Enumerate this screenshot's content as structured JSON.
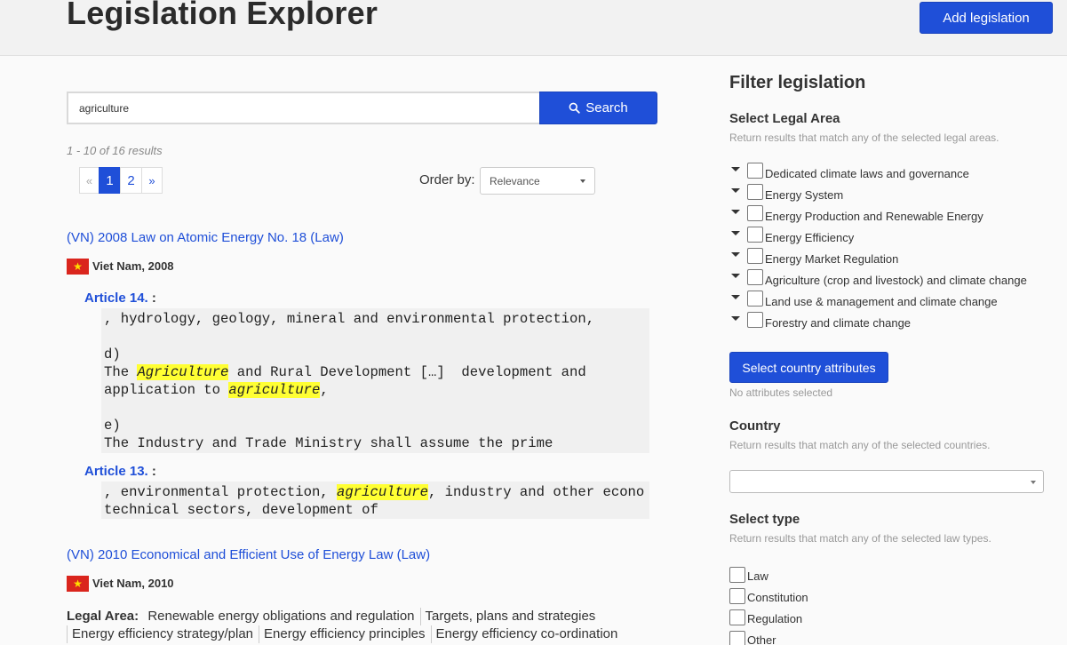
{
  "header": {
    "title": "Legislation Explorer",
    "add_button": "Add legislation"
  },
  "search": {
    "value": "agriculture",
    "button_label": "Search"
  },
  "results": {
    "count_text": "1 - 10 of 16 results",
    "pagination": {
      "prev": "«",
      "pages": [
        "1",
        "2"
      ],
      "current": "1",
      "next": "»"
    },
    "order_label": "Order by:",
    "order_value": "Relevance",
    "items": [
      {
        "title": "(VN) 2008 Law on Atomic Energy No. 18 (Law)",
        "flag": "★",
        "country_year": "Viet Nam, 2008",
        "articles": [
          {
            "label": "Article 14.",
            "colon": " :",
            "lines": [
              ", hydrology, geology, mineral and environmental protection,",
              "",
              "d)",
              "The ",
              "Agriculture",
              " and Rural Development […]  development and",
              "application to ",
              "agriculture",
              ",",
              "",
              "e)",
              "The Industry and Trade Ministry shall assume the prime"
            ]
          },
          {
            "label": "Article 13.",
            "colon": " :",
            "lines": [
              ", environmental protection, ",
              "agriculture",
              ", industry and other econo",
              "technical sectors, development of"
            ]
          }
        ]
      },
      {
        "title": "(VN) 2010 Economical and Efficient Use of Energy Law (Law)",
        "flag": "★",
        "country_year": "Viet Nam, 2010",
        "legal_area_label": "Legal Area:",
        "legal_areas": [
          "Renewable energy obligations and regulation",
          "Targets, plans and strategies",
          "Energy efficiency strategy/plan",
          "Energy efficiency principles",
          "Energy efficiency co-ordination"
        ]
      }
    ]
  },
  "filters": {
    "title": "Filter legislation",
    "legal_area": {
      "title": "Select Legal Area",
      "help": "Return results that match any of the selected legal areas.",
      "items": [
        "Dedicated climate laws and governance",
        "Energy System",
        "Energy Production and Renewable Energy",
        "Energy Efficiency",
        "Energy Market Regulation",
        "Agriculture (crop and livestock) and climate change",
        "Land use & management and climate change",
        "Forestry and climate change"
      ]
    },
    "attributes": {
      "button_label": "Select country attributes",
      "status": "No attributes selected"
    },
    "country": {
      "title": "Country",
      "help": "Return results that match any of the selected countries.",
      "value": ""
    },
    "type": {
      "title": "Select type",
      "help": "Return results that match any of the selected law types.",
      "items": [
        "Law",
        "Constitution",
        "Regulation",
        "Other"
      ]
    }
  },
  "colors": {
    "primary": "#1f4fd8",
    "highlight": "#ffff33",
    "flag_red": "#da251d",
    "flag_star": "#ffde00"
  }
}
